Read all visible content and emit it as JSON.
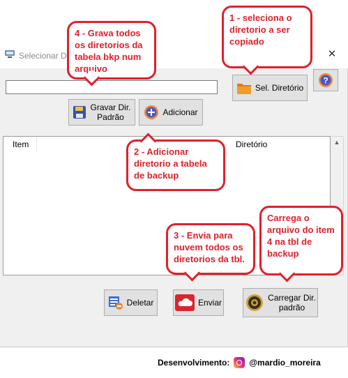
{
  "window": {
    "title": "Selecionar Diretorios",
    "minimize": "—",
    "maximize": "☐",
    "close": "✕"
  },
  "path_input": {
    "value": ""
  },
  "buttons": {
    "sel_diretorio": "Sel. Diretório",
    "help": "?",
    "gravar_line1": "Gravar Dir.",
    "gravar_line2": "Padrão",
    "adicionar": "Adicionar",
    "deletar": "Deletar",
    "enviar": "Enviar",
    "carregar_line1": "Carregar Dir.",
    "carregar_line2": "padrão"
  },
  "table": {
    "columns": [
      "Item",
      "Diretório"
    ],
    "rows": []
  },
  "annotations": {
    "a1": "1 - seleciona o diretorio a ser copiado",
    "a2": "2 - Adicionar diretorio a tabela de backup",
    "a3": "3 - Envia para nuvem todos os diretorios da tbl.",
    "a4": "4 - Grava todos os diretorios da tabela bkp num arquivo",
    "a5": "Carrega o arquivo do item 4 na tbl de backup"
  },
  "footer": {
    "label": "Desenvolvimento:",
    "handle": "@mardio_moreira"
  },
  "colors": {
    "annotation_red": "#e0202a",
    "window_bg": "#f0f0f0",
    "button_bg": "#e1e1e1"
  },
  "icons": [
    "app-icon",
    "folder-icon",
    "help-icon",
    "save-icon",
    "add-icon",
    "delete-icon",
    "cloud-icon",
    "gear-icon",
    "instagram-icon"
  ]
}
